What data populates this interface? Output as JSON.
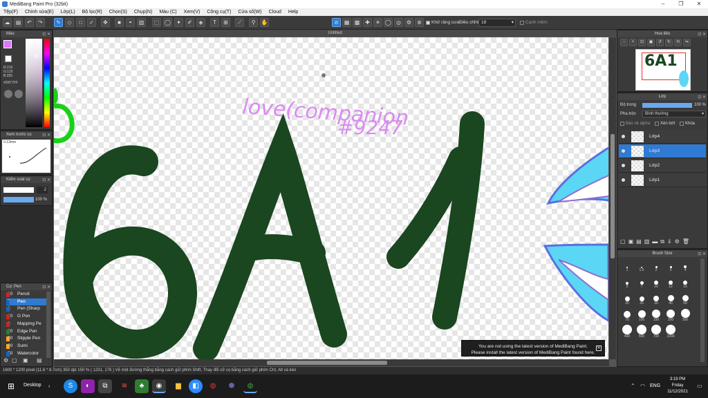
{
  "window": {
    "title": "MediBang Paint Pro (32bit)"
  },
  "menu": [
    "Tệp(F)",
    "Chỉnh sửa(E)",
    "Lớp(L)",
    "Bộ lọc(R)",
    "Chọn(S)",
    "Chụp(N)",
    "Màu (C)",
    "Xem(V)",
    "Công cụ(T)",
    "Cửa sổ(W)",
    "Cloud",
    "Help"
  ],
  "toolbar": {
    "antialias_label": "Khử răng cưa",
    "adjust_label": "Điều chỉnh",
    "adjust_value": "18",
    "edge_label": "Cạnh mềm"
  },
  "color_panel": {
    "title": "Màu",
    "r": "R:216",
    "g": "G:119",
    "b": "B:255",
    "hex": "#D877FF",
    "primary_color": "#d877ff"
  },
  "brush_preview": {
    "title": "Xem trước cọ",
    "size_text": "0.13mm"
  },
  "brush_control": {
    "title": "Kiểm soát cọ",
    "size": "2",
    "opacity": "100 %"
  },
  "brush_list": {
    "title": "Cọ: Pen",
    "items": [
      {
        "size": "10",
        "name": "Pencil",
        "color": "#c62828"
      },
      {
        "size": "2",
        "name": "Pen",
        "color": "#1565c0"
      },
      {
        "size": "8",
        "name": "Pen (Sharp",
        "color": "#1565c0"
      },
      {
        "size": "10",
        "name": "G Pen",
        "color": "#c62828"
      },
      {
        "size": "8",
        "name": "Mapping Pe",
        "color": "#c62828"
      },
      {
        "size": "20",
        "name": "Edge Pen",
        "color": "#2e7d32"
      },
      {
        "size": "50",
        "name": "Stipple Pen",
        "color": "#f9a825"
      },
      {
        "size": "30",
        "name": "Sumi",
        "color": "#f9a825"
      },
      {
        "size": "50",
        "name": "Watercolor",
        "color": "#1565c0"
      }
    ],
    "selected_index": 1
  },
  "document": {
    "tab": "Untitled"
  },
  "canvas_art": {
    "text_main": "6A1",
    "signature_line1": "love(companion",
    "signature_line2": "#9247",
    "stroke_color": "#1a4620",
    "sig_color": "#d98cf0"
  },
  "notice": {
    "line1": "You are not using the latest version of MediBang Paint.",
    "line2": "Please install the latest version of MediBang Paint found here."
  },
  "navigator": {
    "title": "Hoa tiêu"
  },
  "layers": {
    "title": "Lớp",
    "opacity_label": "Độ trong",
    "opacity_value": "100 %",
    "blend_label": "Pha trộn",
    "blend_value": "Bình thường",
    "protect_alpha": "Bảo vệ alpha",
    "clipping": "Xén bớt",
    "lock": "Khóa",
    "items": [
      "Lớp4",
      "Lớp3",
      "Lớp2",
      "Lớp1"
    ],
    "selected_index": 1
  },
  "brush_size": {
    "title": "Brush Size",
    "sizes": [
      "1",
      "1.5",
      "2",
      "3",
      "4",
      "5",
      "7",
      "10",
      "12",
      "15",
      "20",
      "25",
      "30",
      "40",
      "50",
      "70",
      "100",
      "150",
      "200",
      "300",
      "400",
      "500",
      "700",
      "1000"
    ]
  },
  "status": "1600 * 1200 pixel  (11.6 * 8.7cm)  350 dpi  150 %  ( 1231, 176 )  Vẽ một đường thẳng bằng cách giữ phím Shift, Thay đổi cỡ cọ bằng cách giữ phím Ctrl, Alt và kéo",
  "taskbar": {
    "desktop": "Desktop",
    "lang": "ENG",
    "time": "3:19 PM",
    "day": "Friday",
    "date": "11/12/2021"
  }
}
